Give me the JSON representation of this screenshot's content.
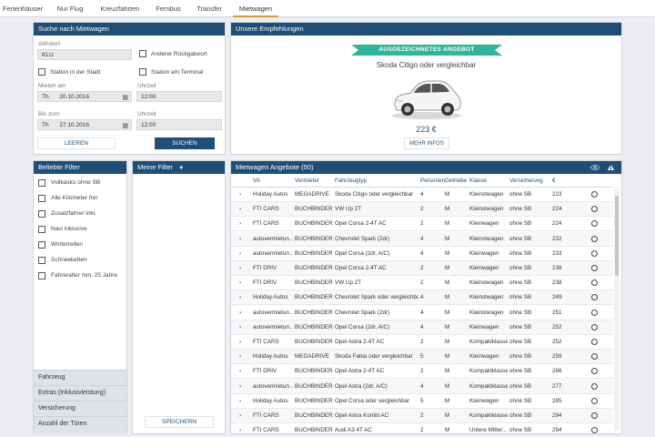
{
  "nav": {
    "tabs": [
      "Ferienhäuser",
      "Nur Flug",
      "Kreuzfahrten",
      "Fernbus",
      "Transfer",
      "Mietwagen"
    ],
    "active": "Mietwagen"
  },
  "search": {
    "title": "Suche nach Mietwagen",
    "pickup_label": "Abholort",
    "pickup_value": "KLU",
    "other_return_label": "Anderer Rückgabeort",
    "station_city_label": "Station in der Stadt",
    "station_terminal_label": "Station am Terminal",
    "rent_label": "Mieten am",
    "rent_day": "Th",
    "rent_date": "20.10.2016",
    "time_label": "Uhrzeit",
    "rent_time": "12:00",
    "until_label": "Bis zum",
    "until_day": "Th",
    "until_date": "27.10.2016",
    "until_time_label": "Uhrzeit",
    "until_time": "12:00",
    "clear_button": "LEEREN",
    "search_button": "SUCHEN"
  },
  "recommend": {
    "title": "Unsere Empfehlungen",
    "ribbon": "AUSGEZEICHNETES ANGEBOT",
    "car_name": "Skoda Citigo oder vergleichbar",
    "price": "223 €",
    "more_button": "MEHR INFOS"
  },
  "popular_filters": {
    "title": "Beliebte Filter",
    "items": [
      "Vollkasko ohne SB",
      "Alle Kilometer frei",
      "Zusatzfahrer inkl.",
      "Navi inklusive",
      "Winterreifen",
      "Schneeketten",
      "Fahreralter min. 25 Jahre"
    ],
    "sections": [
      "Fahrzeug",
      "Extras (Inklusivleistung)",
      "Versicherung",
      "Anzahl der Türen"
    ]
  },
  "my_filters": {
    "title": "Meine Filter",
    "save_button": "SPEICHERN"
  },
  "offers": {
    "title": "Mietwagen Angebote (50)",
    "columns": [
      "VA",
      "Vermieter",
      "Fahrzeugtyp",
      "Personen",
      "Getriebe",
      "Klasse",
      "Versicherung",
      "€"
    ],
    "rows": [
      [
        "Holiday Autos",
        "MEGADRIVE",
        "Skoda Citigo oder vergleichbar",
        "4",
        "M",
        "Kleinstwagen",
        "ohne SB",
        "223"
      ],
      [
        "FTI CARS",
        "BUCHBINDER",
        "VW Up 2T",
        "2",
        "M",
        "Kleinstwagen",
        "ohne SB",
        "224"
      ],
      [
        "FTI CARS",
        "BUCHBINDER",
        "Opel Corsa 2-4T AC",
        "2",
        "M",
        "Kleinwagen",
        "ohne SB",
        "224"
      ],
      [
        "autovermietun...",
        "BUCHBINDER",
        "Chevrolet Spark (2dr)",
        "4",
        "M",
        "Kleinstwagen",
        "ohne SB",
        "232"
      ],
      [
        "autovermietun...",
        "BUCHBINDER",
        "Opel Corsa (2dr, A/C)",
        "4",
        "M",
        "Kleinwagen",
        "ohne SB",
        "233"
      ],
      [
        "FTI DRIV",
        "BUCHBINDER",
        "Opel Corsa 2-4T AC",
        "2",
        "M",
        "Kleinwagen",
        "ohne SB",
        "238"
      ],
      [
        "FTI DRIV",
        "BUCHBINDER",
        "VW Up 2T",
        "2",
        "M",
        "Kleinstwagen",
        "ohne SB",
        "238"
      ],
      [
        "Holiday Autos",
        "BUCHBINDER",
        "Chevrolet Spark oder vergleichbar",
        "4",
        "M",
        "Kleinstwagen",
        "ohne SB",
        "249"
      ],
      [
        "autovermietun...",
        "BUCHBINDER",
        "Chevrolet Spark (2dr)",
        "4",
        "M",
        "Kleinstwagen",
        "ohne SB",
        "251"
      ],
      [
        "autovermietun...",
        "BUCHBINDER",
        "Opel Corsa (2dr, A/C)",
        "4",
        "M",
        "Kleinwagen",
        "ohne SB",
        "252"
      ],
      [
        "FTI CARS",
        "BUCHBINDER",
        "Opel Astra 2-4T AC",
        "2",
        "M",
        "Kompaktklasse",
        "ohne SB",
        "252"
      ],
      [
        "Holiday Autos",
        "MEGADRIVE",
        "Skoda Fabia oder vergleichbar",
        "5",
        "M",
        "Kleinwagen",
        "ohne SB",
        "259"
      ],
      [
        "FTI DRIV",
        "BUCHBINDER",
        "Opel Astra 2-4T AC",
        "2",
        "M",
        "Kompaktklasse",
        "ohne SB",
        "266"
      ],
      [
        "autovermietun...",
        "BUCHBINDER",
        "Opel Astra (2dr, A/C)",
        "4",
        "M",
        "Kompaktklasse",
        "ohne SB",
        "277"
      ],
      [
        "Holiday Autos",
        "BUCHBINDER",
        "Opel Corsa oder vergleichbar",
        "5",
        "M",
        "Kleinwagen",
        "ohne SB",
        "285"
      ],
      [
        "FTI CARS",
        "BUCHBINDER",
        "Opel Astra Kombi AC",
        "2",
        "M",
        "Kompaktklasse",
        "ohne SB",
        "294"
      ],
      [
        "FTI CARS",
        "BUCHBINDER",
        "Audi A3 4T AC",
        "2",
        "M",
        "Untere Mittel...",
        "ohne SB",
        "294"
      ]
    ]
  }
}
